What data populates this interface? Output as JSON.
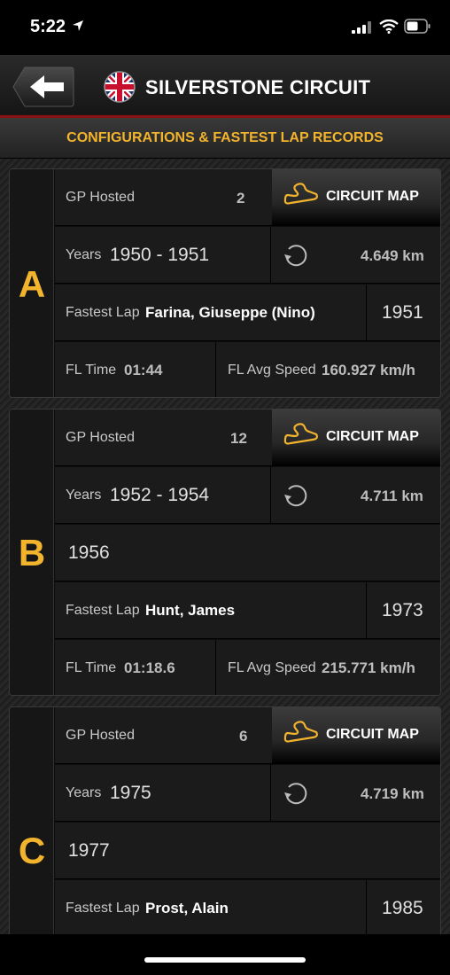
{
  "status_bar": {
    "time": "5:22"
  },
  "header": {
    "title": "SILVERSTONE CIRCUIT"
  },
  "subheader": {
    "title": "CONFIGURATIONS & FASTEST LAP RECORDS"
  },
  "labels": {
    "gp_hosted": "GP Hosted",
    "years": "Years",
    "fastest_lap": "Fastest Lap",
    "fl_time": "FL Time",
    "fl_avg_speed": "FL Avg Speed",
    "circuit_map": "CIRCUIT MAP"
  },
  "configs": [
    {
      "letter": "A",
      "gp_hosted": "2",
      "years": "1950 - 1951",
      "length": "4.649 km",
      "fastest_lap_driver": "Farina, Giuseppe (Nino)",
      "fastest_lap_year": "1951",
      "fl_time": "01:44",
      "fl_avg_speed": "160.927 km/h"
    },
    {
      "letter": "B",
      "gp_hosted": "12",
      "years": "1952 - 1954",
      "length": "4.711 km",
      "extra_year": "1956",
      "fastest_lap_driver": "Hunt, James",
      "fastest_lap_year": "1973",
      "fl_time": "01:18.6",
      "fl_avg_speed": "215.771 km/h"
    },
    {
      "letter": "C",
      "gp_hosted": "6",
      "years": "1975",
      "length": "4.719 km",
      "extra_year": "1977",
      "fastest_lap_driver": "Prost, Alain",
      "fastest_lap_year": "1985"
    }
  ],
  "colors": {
    "accent": "#f2b32d",
    "header_line": "#8a1212"
  }
}
